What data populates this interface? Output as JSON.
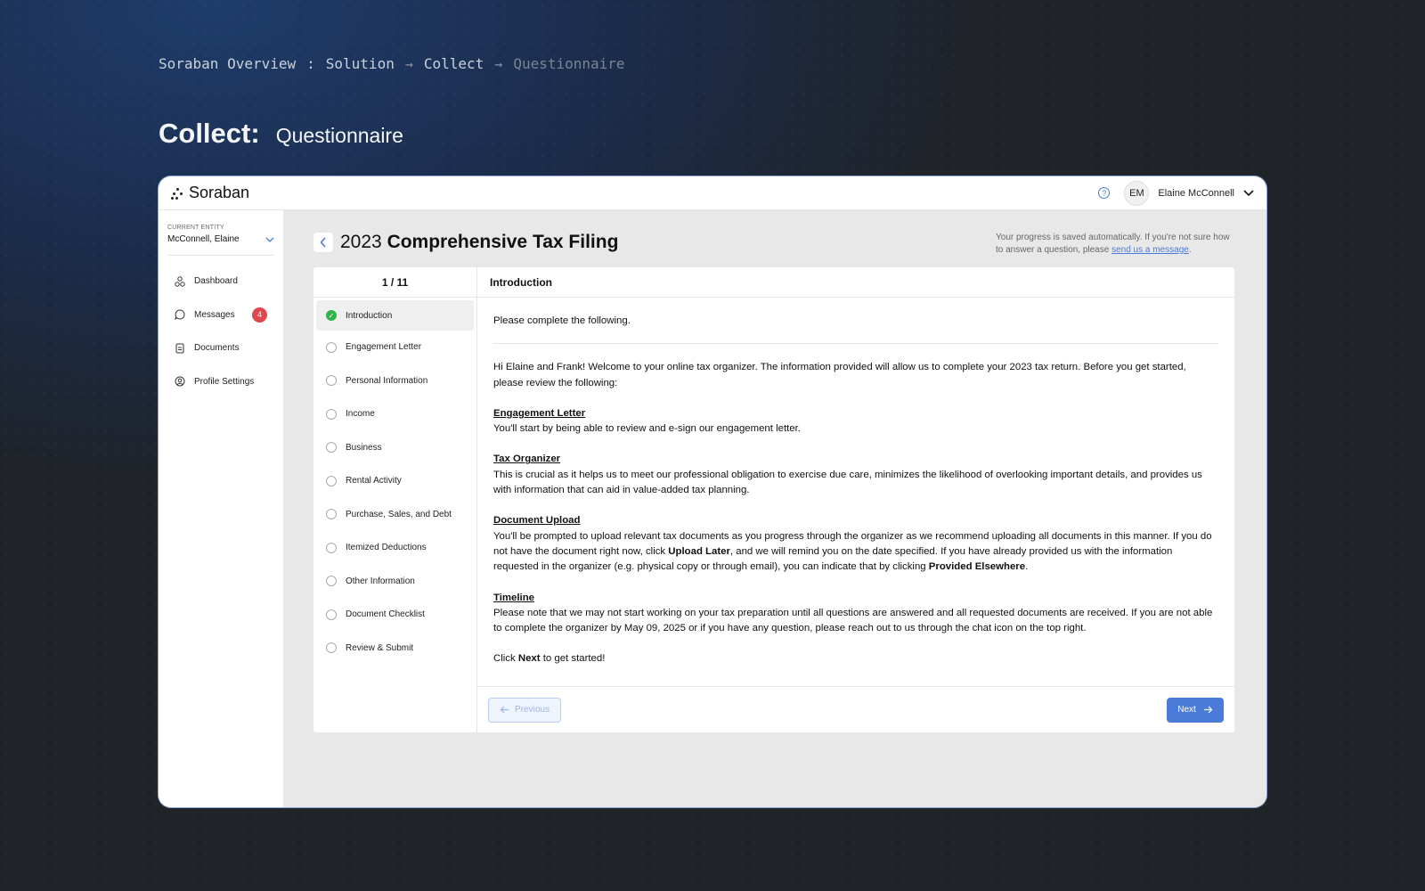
{
  "breadcrumb": {
    "items": [
      "Soraban Overview",
      ":",
      "Solution",
      "Collect",
      "Questionnaire"
    ]
  },
  "heading": {
    "main": "Collect:",
    "sub": "Questionnaire"
  },
  "app": {
    "brand": "Soraban",
    "user_initials": "EM",
    "user_name": "Elaine McConnell"
  },
  "sidebar": {
    "entity_label": "CURRENT ENTITY",
    "entity_name": "McConnell, Elaine",
    "items": [
      {
        "label": "Dashboard",
        "icon": "dashboard-icon"
      },
      {
        "label": "Messages",
        "icon": "chat-icon",
        "badge": "4"
      },
      {
        "label": "Documents",
        "icon": "document-icon"
      },
      {
        "label": "Profile Settings",
        "icon": "profile-settings-icon"
      }
    ]
  },
  "main": {
    "title_year": "2023",
    "title_rest": "Comprehensive Tax Filing",
    "save_note_text": "Your progress is saved automatically. If you're not sure how to answer a question, please",
    "save_note_link": "send us a message",
    "save_note_end": "."
  },
  "steps": {
    "counter": "1 / 11",
    "items": [
      "Introduction",
      "Engagement Letter",
      "Personal Information",
      "Income",
      "Business",
      "Rental Activity",
      "Purchase, Sales, and Debt",
      "Itemized Deductions",
      "Other Information",
      "Document Checklist",
      "Review & Submit"
    ],
    "completed_index": 0
  },
  "content": {
    "header": "Introduction",
    "intro": "Please complete the following.",
    "welcome": "Hi Elaine and Frank! Welcome to your online tax organizer. The information provided will allow us to complete your 2023 tax return. Before you get started, please review the following:",
    "engagement_title": "Engagement Letter",
    "engagement_text": "You'll start by being able to review and e-sign our engagement letter.",
    "organizer_title": "Tax Organizer",
    "organizer_text": "This is crucial as it helps us to meet our professional obligation to exercise due care, minimizes the likelihood of overlooking important details, and provides us with information that can aid in value-added tax planning.",
    "upload_title": "Document Upload",
    "upload_text_1": "You'll be prompted to upload relevant tax documents as you progress through the organizer as we recommend uploading all documents in this manner. If you do not have the document right now, click ",
    "upload_bold_1": "Upload Later",
    "upload_text_2": ", and we will remind you on the date specified. If you have already provided us with the information requested in the organizer (e.g. physical copy or through email), you can indicate that by clicking ",
    "upload_bold_2": "Provided Elsewhere",
    "upload_text_3": ".",
    "timeline_title": "Timeline",
    "timeline_text": "Please note that we may not start working on your tax preparation until all questions are answered and all requested documents are received. If you are not able to complete the organizer by May 09, 2025 or if you have any question, please reach out to us through the chat icon on the top right.",
    "click_1": "Click ",
    "click_bold": "Next",
    "click_2": " to get started!",
    "prev_label": "Previous",
    "next_label": "Next"
  },
  "colors": {
    "accent": "#4a7bd8",
    "badge": "#e0484d",
    "success": "#2fb44a"
  }
}
